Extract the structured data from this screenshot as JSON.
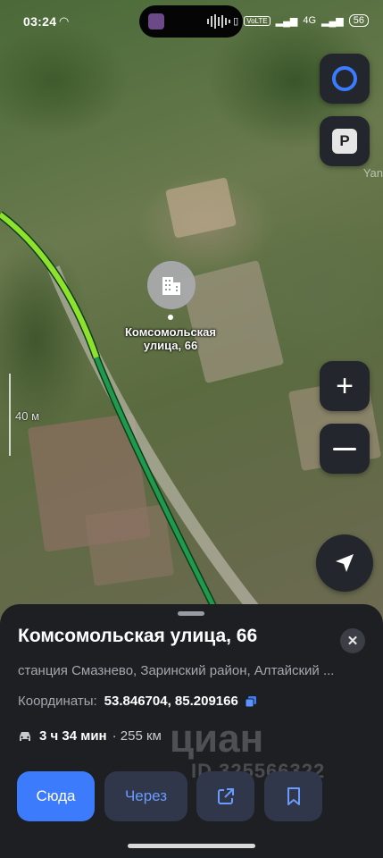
{
  "status_bar": {
    "time": "03:24",
    "signal_text": "4G",
    "battery": "56"
  },
  "map": {
    "poi_label": "Комсомольская улица, 66",
    "scale_label": "40 м",
    "brand_watermark": "Yan",
    "route_colors": {
      "traffic_free": "#8ee22c",
      "route": "#1f9a4c"
    }
  },
  "sheet": {
    "title": "Комсомольская улица, 66",
    "address": "станция Смазнево, Заринский район, Алтайский ...",
    "coords_label": "Координаты:",
    "coords_value": "53.846704, 85.209166",
    "route_time": "3 ч 34 мин",
    "route_distance": "· 255 км",
    "watermark_brand": "циан",
    "watermark_id": "ID 325566322",
    "buttons": {
      "here": "Сюда",
      "via": "Через"
    },
    "accent_color": "#3d7bfd"
  }
}
